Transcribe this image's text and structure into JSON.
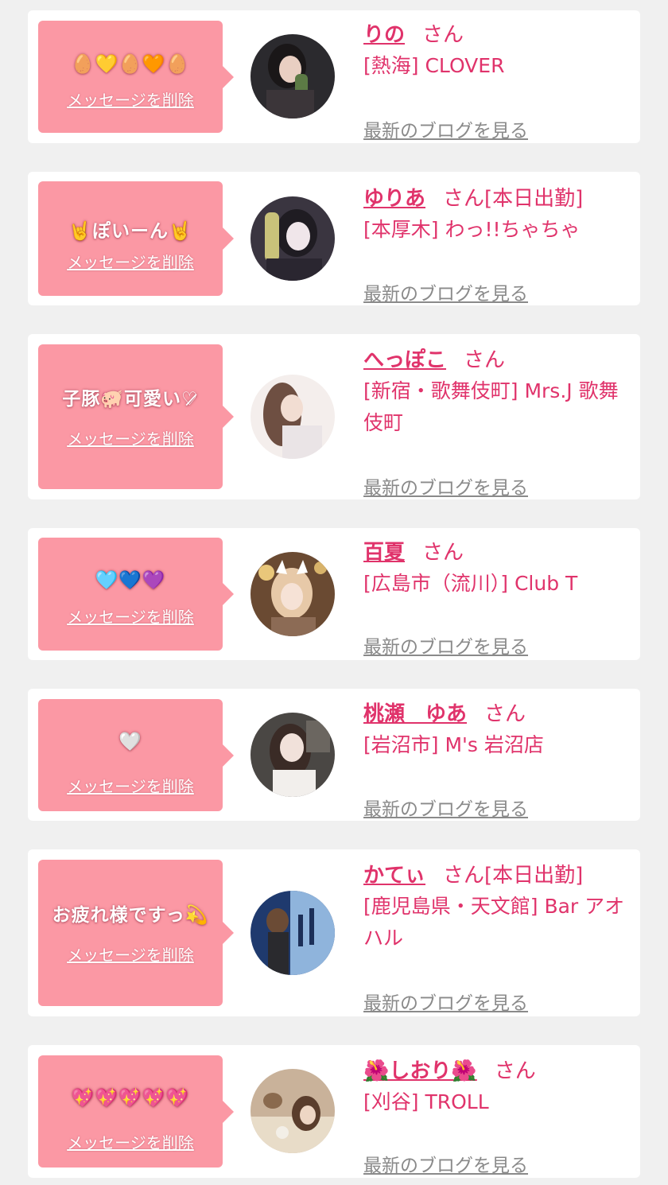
{
  "colors": {
    "page_bg": "#f0f0f0",
    "card_bg": "#ffffff",
    "bubble_bg": "#fb98a4",
    "name_color": "#e0336b",
    "link_gray": "#8a8a8a"
  },
  "entries": [
    {
      "message": "🥚💛🥚🧡🥚",
      "delete_label": "メッセージを削除",
      "name": "りの",
      "suffix": "さん",
      "shop": "[熱海] CLOVER",
      "blog_label": "最新のブログを見る",
      "avatar_icon": "profile-photo-dark"
    },
    {
      "message": "🤘ぽいーん🤘",
      "delete_label": "メッセージを削除",
      "name": "ゆりあ",
      "suffix": "さん[本日出勤]",
      "shop": "[本厚木] わっ!!ちゃちゃ",
      "blog_label": "最新のブログを見る",
      "avatar_icon": "profile-photo-dark"
    },
    {
      "message": "子豚🐖可愛い♡̷",
      "delete_label": "メッセージを削除",
      "name": "へっぽこ",
      "suffix": "さん",
      "shop": "[新宿・歌舞伎町] Mrs.J 歌舞伎町",
      "blog_label": "最新のブログを見る",
      "avatar_icon": "profile-photo-light"
    },
    {
      "message": "🩵💙💜",
      "delete_label": "メッセージを削除",
      "name": "百夏",
      "suffix": "さん",
      "shop": "[広島市（流川）] Club T",
      "blog_label": "最新のブログを見る",
      "avatar_icon": "profile-photo-warm"
    },
    {
      "message": "🤍",
      "delete_label": "メッセージを削除",
      "name": "桃瀬　ゆあ",
      "suffix": "さん",
      "shop": "[岩沼市] M's 岩沼店",
      "blog_label": "最新のブログを見る",
      "avatar_icon": "profile-photo-dark"
    },
    {
      "message": "お疲れ様ですっ💫",
      "delete_label": "メッセージを削除",
      "name": "かてぃ",
      "suffix": "さん[本日出勤]",
      "shop": "[鹿児島県・天文館] Bar アオハル",
      "blog_label": "最新のブログを見る",
      "avatar_icon": "profile-photo-blue"
    },
    {
      "message": "💖💖💖💖💖",
      "delete_label": "メッセージを削除",
      "name": "🌺しおり🌺",
      "suffix": "さん",
      "shop": "[刈谷] TROLL",
      "blog_label": "最新のブログを見る",
      "avatar_icon": "profile-photo-warm"
    }
  ]
}
